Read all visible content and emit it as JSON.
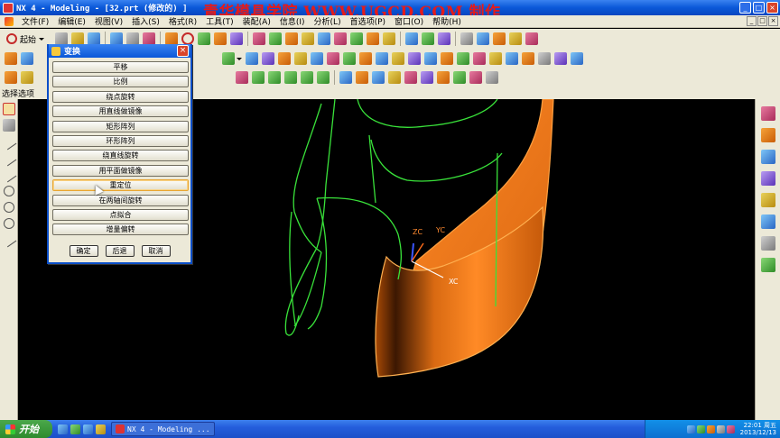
{
  "window": {
    "title": "NX 4 - Modeling - [32.prt (修改的) ]",
    "watermark": "青华模具学院 WWW.UGCD.COM 制作",
    "controls": [
      "_",
      "□",
      "×"
    ]
  },
  "menubar": {
    "items": [
      "文件(F)",
      "编辑(E)",
      "视图(V)",
      "插入(S)",
      "格式(R)",
      "工具(T)",
      "装配(A)",
      "信息(I)",
      "分析(L)",
      "首选项(P)",
      "窗口(O)",
      "帮助(H)"
    ],
    "mdi_controls": [
      "_",
      "□",
      "×"
    ]
  },
  "toolbar": {
    "start_label": "起始",
    "icons": [
      "new-icon",
      "open-icon",
      "save-icon",
      "print-icon",
      "undo-icon",
      "redo-icon",
      "sketch-icon",
      "curve-icon"
    ]
  },
  "selection": {
    "label": "选择选项"
  },
  "dialog": {
    "title": "变换",
    "close": "×",
    "options": [
      "平移",
      "比例",
      "绕点旋转",
      "用直线做镜像",
      "矩形阵列",
      "环形阵列",
      "绕直线旋转",
      "用平面做镜像",
      "重定位",
      "在两轴间旋转",
      "点拟合",
      "增量偏转"
    ],
    "hovered_index": 8,
    "ok": "确定",
    "back": "后退",
    "cancel": "取消"
  },
  "csys": {
    "zc": "ZC",
    "yc": "YC",
    "xc": "XC"
  },
  "colors": {
    "wireframe": "#39e23a",
    "surface": "#ff7a14",
    "csys_x": "#ffffff",
    "csys_y": "#ff6c1a",
    "csys_z": "#3a55ff"
  },
  "taskbar": {
    "start": "开始",
    "task": "NX 4 - Modeling ...",
    "time": "22:01 周五",
    "date": "2013/12/13"
  }
}
